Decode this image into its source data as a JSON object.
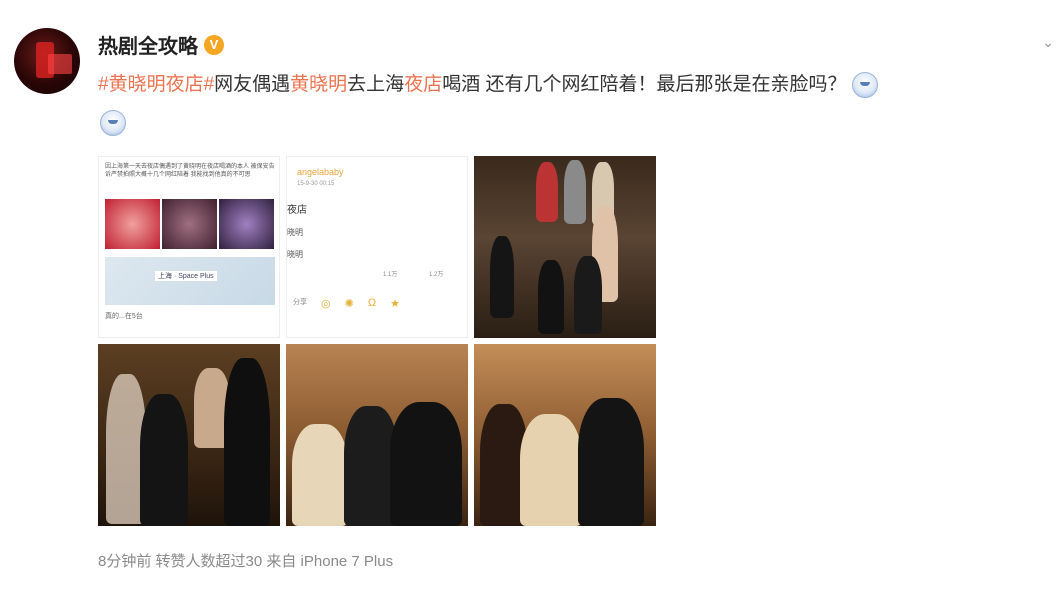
{
  "post": {
    "author": "热剧全攻略",
    "verified_badge": "V",
    "content": {
      "tag1": "#黄晓明夜店#",
      "part1": "网友偶遇",
      "hl1": "黄晓明",
      "part2": "去上海",
      "hl2": "夜店",
      "part3": "喝酒 还有几个网红陪着！最后那张是在亲脸吗？"
    },
    "footer": {
      "time": "8分钟前",
      "reposts": "转赞人数超过30",
      "source": "来自 iPhone 7 Plus"
    }
  },
  "images": {
    "img1": {
      "text": "因上海第一天去夜店偶遇到了黄晓明在夜店喝酒的本人 被保安告诉严禁拍照大概十几个网红陪着 我能找到他真的不可思",
      "map_label": "上海 · Space Plus",
      "footer": "真的...在5台"
    },
    "img2": {
      "user": "angelababy",
      "time": "15-9-30 00:15",
      "tag": "夜店",
      "line1": "晓明",
      "line2": "晓明",
      "count1": "1.1万",
      "count2": "1.2万",
      "share": "分享"
    }
  }
}
